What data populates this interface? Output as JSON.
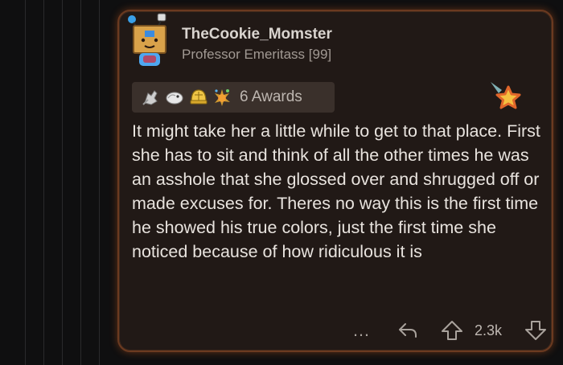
{
  "comment": {
    "username": "TheCookie_Momster",
    "flair": "Professor Emeritass [99]",
    "awards": {
      "count_label": "6 Awards",
      "icons": [
        "hand-award-icon",
        "dove-award-icon",
        "golden-helmet-award-icon",
        "sparkle-explosion-award-icon"
      ]
    },
    "badge": "star-badge-icon",
    "body": "It might take her a little while to get to that place. First she has to sit and think of all the other times he was an asshole that she glossed over and shrugged off or made excuses for. Theres no way this is the first time he showed his true colors, just the first time she noticed because of how ridiculous it is",
    "actions": {
      "more": "…",
      "score": "2.3k"
    }
  },
  "colors": {
    "card_background": "#211916",
    "card_border": "#6b3a20",
    "page_background": "#0f0f10",
    "text": "#e8e3de",
    "muted_text": "#a19993"
  }
}
